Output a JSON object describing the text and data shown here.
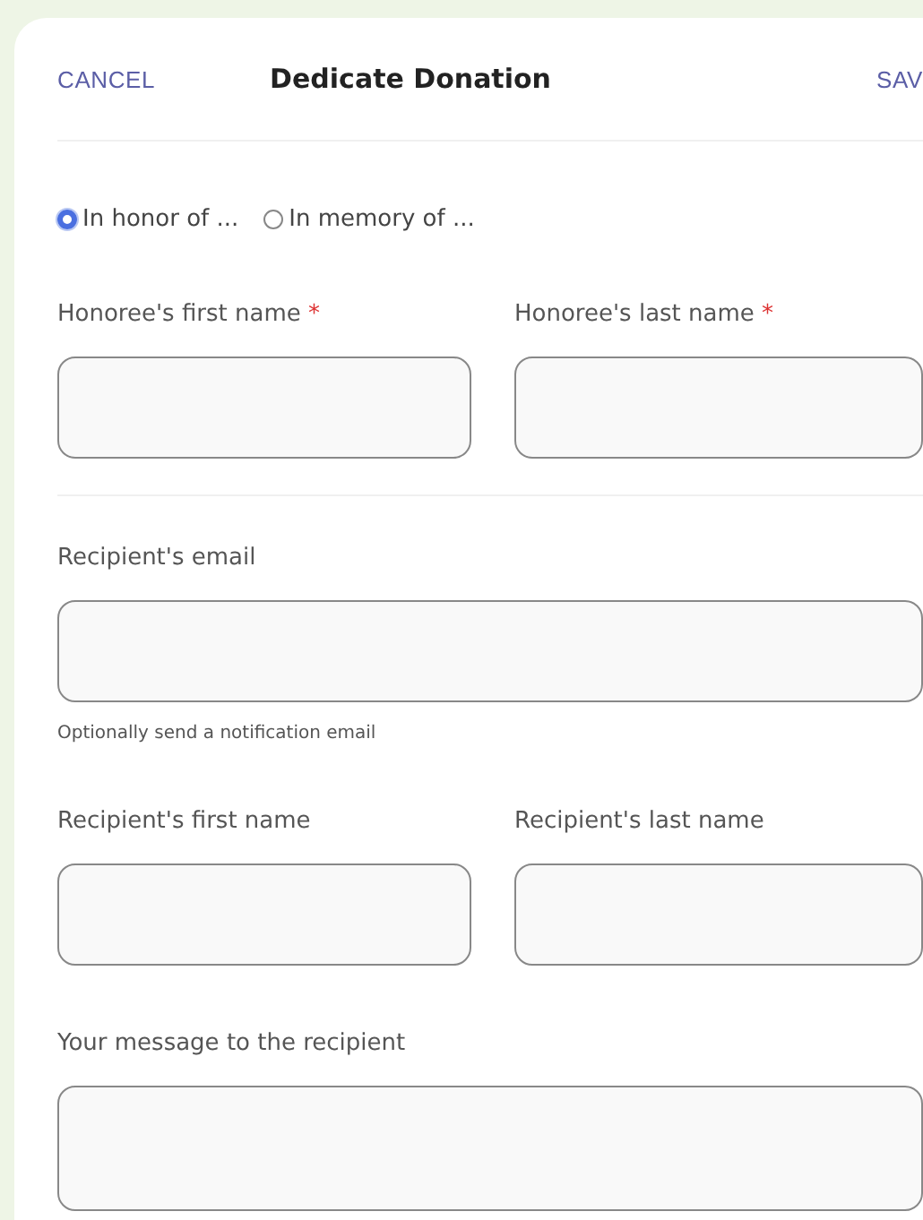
{
  "header": {
    "cancel": "CANCEL",
    "title": "Dedicate Donation",
    "save": "SAV"
  },
  "dedication_type": [
    {
      "label": "In honor of ...",
      "selected": true
    },
    {
      "label": "In memory of ...",
      "selected": false
    }
  ],
  "groups": [
    {
      "rows": [
        [
          {
            "label": "Honoree's first name",
            "mark": "*",
            "kind": "input"
          },
          {
            "label": "Honoree's last name",
            "mark": "*",
            "kind": "input"
          }
        ]
      ]
    },
    {
      "rows": [
        [
          {
            "label": "Recipient's email",
            "kind": "input",
            "help": "Optionally send a notification email"
          }
        ],
        [
          {
            "label": "Recipient's first name",
            "kind": "input"
          },
          {
            "label": "Recipient's last name",
            "kind": "input"
          }
        ],
        [
          {
            "label": "Your message to the recipient",
            "kind": "textarea"
          }
        ]
      ]
    }
  ]
}
